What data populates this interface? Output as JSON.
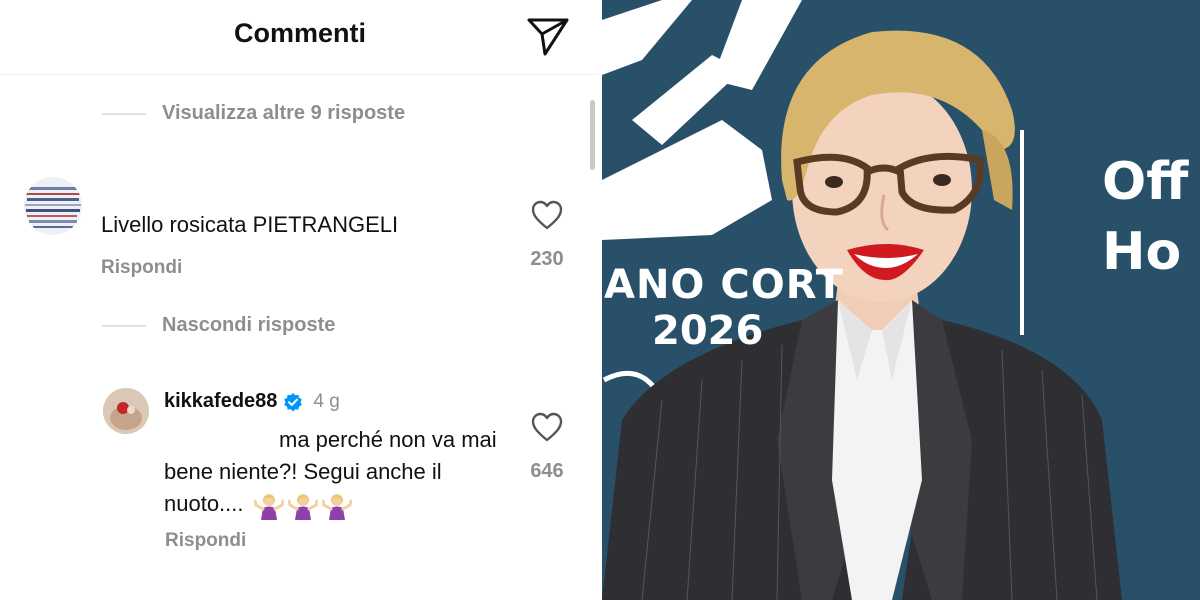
{
  "header": {
    "title": "Commenti",
    "share_icon": "paper-plane-icon"
  },
  "thread": {
    "view_more_label": "Visualizza altre 9 risposte",
    "hide_replies_label": "Nascondi risposte"
  },
  "comments": [
    {
      "text": "Livello rosicata PIETRANGELI",
      "reply_label": "Rispondi",
      "likes": "230"
    },
    {
      "username": "kikkafede88",
      "verified": true,
      "time": "4 g",
      "text": "ma perché non va mai bene niente?! Segui anche il nuoto....",
      "emojis": [
        "woman-shrugging",
        "woman-shrugging",
        "woman-shrugging"
      ],
      "reply_label": "Rispondi",
      "likes": "646"
    }
  ],
  "photo": {
    "backdrop_lines": [
      "ANO CORT",
      "2026",
      "Off",
      "Ho"
    ],
    "colors": {
      "backdrop": "#285069",
      "hair": "#d8b56d",
      "jacket": "#2e2e33",
      "shirt": "#f3f3f3",
      "lips": "#d11a20"
    }
  }
}
